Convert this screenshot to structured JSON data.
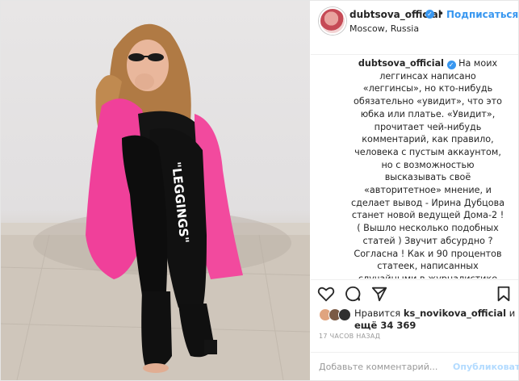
{
  "header": {
    "username": "dubtsova_official",
    "separator": "•",
    "follow_label": "Подписаться",
    "location": "Moscow, Russia"
  },
  "photo": {
    "print_text": "\"LEGGINGS\"",
    "colors": {
      "jacket": "#f03d95",
      "wall": "#e6e4e4",
      "floor": "#cfc7bd",
      "outfit": "#111111"
    }
  },
  "caption": {
    "username": "dubtsova_official",
    "text": "На моих леггинсах написано «леггинсы», но кто-нибудь обязательно «увидит», что это юбка или платье. «Увидит», прочитает чей-нибудь комментарий, как правило, человека с пустым аккаунтом, но с возможностью высказывать своё «авторитетное» мнение, и сделает вывод - Ирина Дубцова станет новой ведущей Дома-2 ! ( Вышло несколько подобных статей ) Звучит абсурдно ? Согласна ! Как и 90 процентов статеек, написанных случайными в журналистике людьми, не имеющими соответствующего образования, да и вообще отношения к этой профессии. Или какой-нибудь"
  },
  "actions": {
    "like_icon": "heart-icon",
    "comment_icon": "comment-icon",
    "share_icon": "share-icon",
    "save_icon": "bookmark-icon"
  },
  "likes": {
    "prefix": "Нравится",
    "user": "ks_novikova_official",
    "middle": "и",
    "more_label": "ещё 34 369"
  },
  "timestamp": "17 ЧАСОВ НАЗАД",
  "comment_box": {
    "placeholder": "Добавьте комментарий...",
    "post_label": "Опубликовать"
  }
}
